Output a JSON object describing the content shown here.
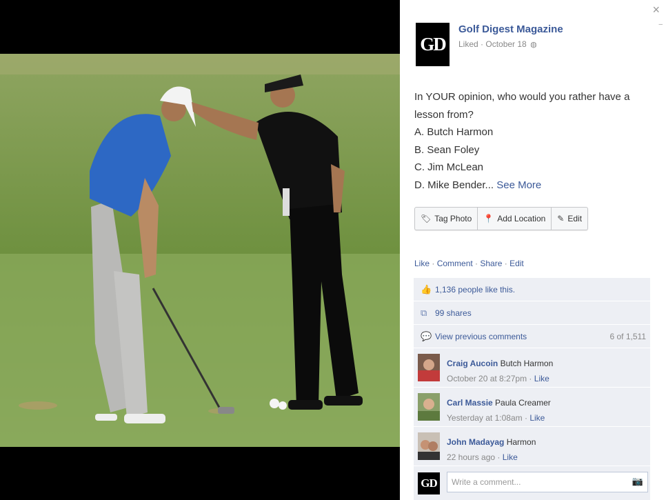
{
  "window": {
    "close_label": "×"
  },
  "page": {
    "logo_text": "GD",
    "name": "Golf Digest Magazine",
    "status": "Liked",
    "date": "October 18",
    "privacy_icon": "globe-icon"
  },
  "post": {
    "lines": [
      "In YOUR opinion, who would you rather have a",
      "lesson from?",
      "A. Butch Harmon",
      "B. Sean Foley",
      "C. Jim McLean"
    ],
    "last_line": "D. Mike Bender...",
    "see_more": "See More"
  },
  "photo_actions": [
    {
      "label": "Tag Photo",
      "icon": "tag-icon"
    },
    {
      "label": "Add Location",
      "icon": "location-pin-icon"
    },
    {
      "label": "Edit",
      "icon": "pencil-icon"
    }
  ],
  "ufi_links": {
    "like": "Like",
    "comment": "Comment",
    "share": "Share",
    "edit": "Edit",
    "sep": " · "
  },
  "stats": {
    "likes": "1,136 people like this.",
    "shares": "99 shares",
    "view_previous": "View previous comments",
    "comment_count": "6 of 1,511"
  },
  "comments": [
    {
      "name": "Craig Aucoin",
      "text": "Butch Harmon",
      "time": "October 20 at 8:27pm",
      "like": "Like"
    },
    {
      "name": "Carl Massie",
      "text": "Paula Creamer",
      "time": "Yesterday at 1:08am",
      "like": "Like"
    },
    {
      "name": "John Madayag",
      "text": "Harmon",
      "time": "22 hours ago",
      "like": "Like"
    }
  ],
  "composer": {
    "placeholder": "Write a comment...",
    "avatar_text": "GD"
  },
  "colors": {
    "link": "#3b5998",
    "ufi_bg": "#edeff4",
    "viewer_bg": "#000000"
  }
}
